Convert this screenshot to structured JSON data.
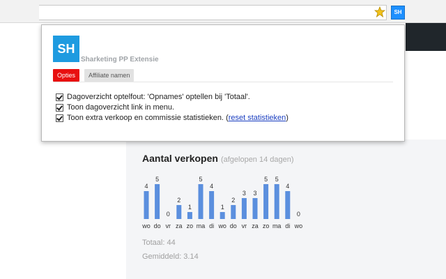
{
  "browser": {
    "extension_button_label": "SH",
    "colors": {
      "extension": "#1e90ff",
      "star": "#f2c21b"
    }
  },
  "popup": {
    "logo_text": "SH",
    "title": "Sharketing PP Extensie",
    "tabs": [
      {
        "label": "Opties",
        "active": true
      },
      {
        "label": "Affiliate namen",
        "active": false
      }
    ],
    "options": [
      {
        "label": "Dagoverzicht optelfout: 'Opnames' optellen bij 'Totaal'.",
        "checked": true
      },
      {
        "label": "Toon dagoverzicht link in menu.",
        "checked": true
      },
      {
        "label": "Toon extra verkoop en commissie statistieken.",
        "checked": true,
        "link_prefix": "(",
        "link_text": "reset statistieken",
        "link_suffix": ")"
      }
    ],
    "colors": {
      "logo": "#1e9be0",
      "active_tab": "#e81010",
      "link": "#1a3ec0"
    }
  },
  "stats_card": {
    "title": "Aantal verkopen",
    "subtitle": "(afgelopen 14 dagen)",
    "total_label": "Totaal: 44",
    "average_label": "Gemiddeld: 3.14",
    "chart_data": {
      "type": "bar",
      "title": "Aantal verkopen",
      "subtitle": "(afgelopen 14 dagen)",
      "categories": [
        "wo",
        "do",
        "vr",
        "za",
        "zo",
        "ma",
        "di",
        "wo",
        "do",
        "vr",
        "za",
        "zo",
        "ma",
        "di",
        "wo"
      ],
      "values": [
        4,
        5,
        0,
        2,
        1,
        5,
        4,
        1,
        2,
        3,
        3,
        5,
        5,
        4,
        0
      ],
      "xlabel": "",
      "ylabel": "",
      "ylim": [
        0,
        5
      ],
      "grid": false,
      "bar_color": "#5b8fde"
    }
  }
}
